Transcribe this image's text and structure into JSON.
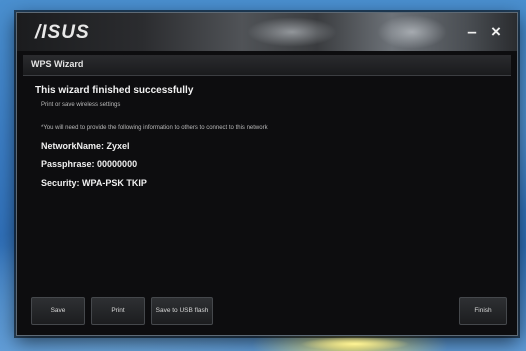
{
  "window": {
    "logo": "/ISUS",
    "minimize_label": "–",
    "close_label": "×"
  },
  "subheader": {
    "title": "WPS Wizard"
  },
  "content": {
    "heading": "This wizard finished successfully",
    "subtext": "Print or save wireless settings",
    "note": "*You will need to provide the following information to others to connect to this network",
    "network_name": "NetworkName: Zyxel",
    "passphrase": "Passphrase: 00000000",
    "security": "Security: WPA-PSK TKIP"
  },
  "buttons": {
    "save": "Save",
    "print": "Print",
    "save_usb": "Save to USB flash",
    "finish": "Finish"
  },
  "colors": {
    "window_bg": "#0d0d0f",
    "desktop_bg": "#3b7dc4",
    "text": "#f0f0f0"
  }
}
